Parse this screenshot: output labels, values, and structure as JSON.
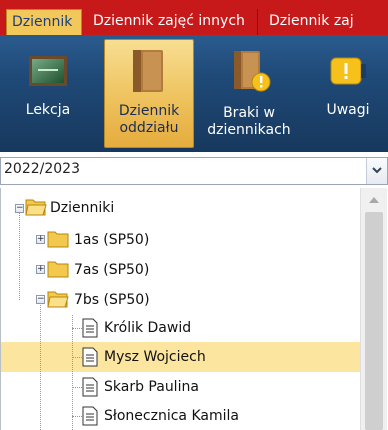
{
  "tabs": [
    "Dziennik",
    "Dziennik zajęć innych",
    "Dziennik zaj"
  ],
  "ribbon": {
    "buttons": [
      {
        "label": "Lekcja"
      },
      {
        "label": "Dziennik\noddziału"
      },
      {
        "label": "Braki w\ndziennikach"
      },
      {
        "label": "Uwagi"
      }
    ]
  },
  "year_select": {
    "value": "2022/2023"
  },
  "tree": {
    "root": "Dzienniki",
    "classes": [
      "1as (SP50)",
      "7as (SP50)",
      "7bs (SP50)"
    ],
    "students": [
      "Królik Dawid",
      "Mysz Wojciech",
      "Skarb Paulina",
      "Słonecznica Kamila"
    ]
  },
  "colors": {
    "tab_bar": "#c8191a",
    "ribbon": "#1f4a78",
    "active": "#f3c85b",
    "selection": "#fce59e"
  }
}
